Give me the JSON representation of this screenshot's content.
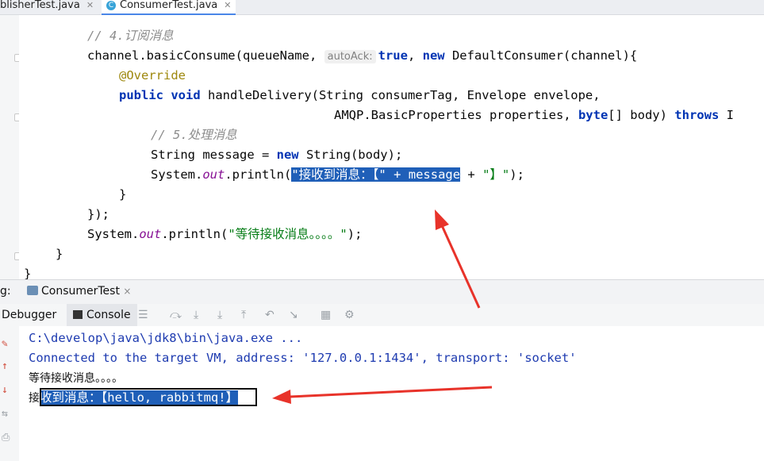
{
  "tabs": [
    {
      "label": "blisherTest.java"
    },
    {
      "label": "ConsumerTest.java",
      "icon": "C"
    }
  ],
  "editor": {
    "comment_subscribe": "// 4.订阅消息",
    "consume_call_prefix": "channel.basicConsume(queueName, ",
    "param_hint": "autoAck:",
    "consume_true": "true",
    "consume_mid": ", ",
    "consume_new": "new",
    "consume_suffix": " DefaultConsumer(channel){",
    "override": "@Override",
    "kw_public": "public",
    "kw_void": "void",
    "method_sig": " handleDelivery(String consumerTag, Envelope envelope,",
    "params_line2_a": "AMQP.BasicProperties properties, ",
    "kw_byte": "byte",
    "params_line2_b": "[] body) ",
    "kw_throws": "throws",
    "params_line2_c": " I",
    "comment_process": "// 5.处理消息",
    "msg_decl_a": "String message = ",
    "kw_new": "new",
    "msg_decl_b": " String(body);",
    "println_a": "System.",
    "println_out": "out",
    "println_b": ".println(",
    "println_sel": "\"接收到消息：【\" + message",
    "println_c": " + ",
    "println_str2": "\"】\"",
    "println_d": ");",
    "close_brace": "}",
    "close_paren": "});",
    "wait_a": "System.",
    "wait_out": "out",
    "wait_b": ".println(",
    "wait_str": "\"等待接收消息。。。。\"",
    "wait_c": ");",
    "close_method": "}",
    "close_class": "}"
  },
  "run_panel": {
    "label": "g:",
    "tab_label": "ConsumerTest",
    "tab_close": "×"
  },
  "toolbar": {
    "debugger": "Debugger",
    "console": "Console"
  },
  "console": {
    "line1": "C:\\develop\\java\\jdk8\\bin\\java.exe ...",
    "line2": "Connected to the target VM, address: '127.0.0.1:1434', transport: 'socket'",
    "line3": "等待接收消息。。。。",
    "line4_a": "接",
    "line4_sel": "收到消息：【hello, rabbitmq!】"
  },
  "colors": {
    "selection": "#1f5fb8",
    "arrow": "#e8332a",
    "keyword": "#0033b3",
    "string": "#067d17"
  }
}
